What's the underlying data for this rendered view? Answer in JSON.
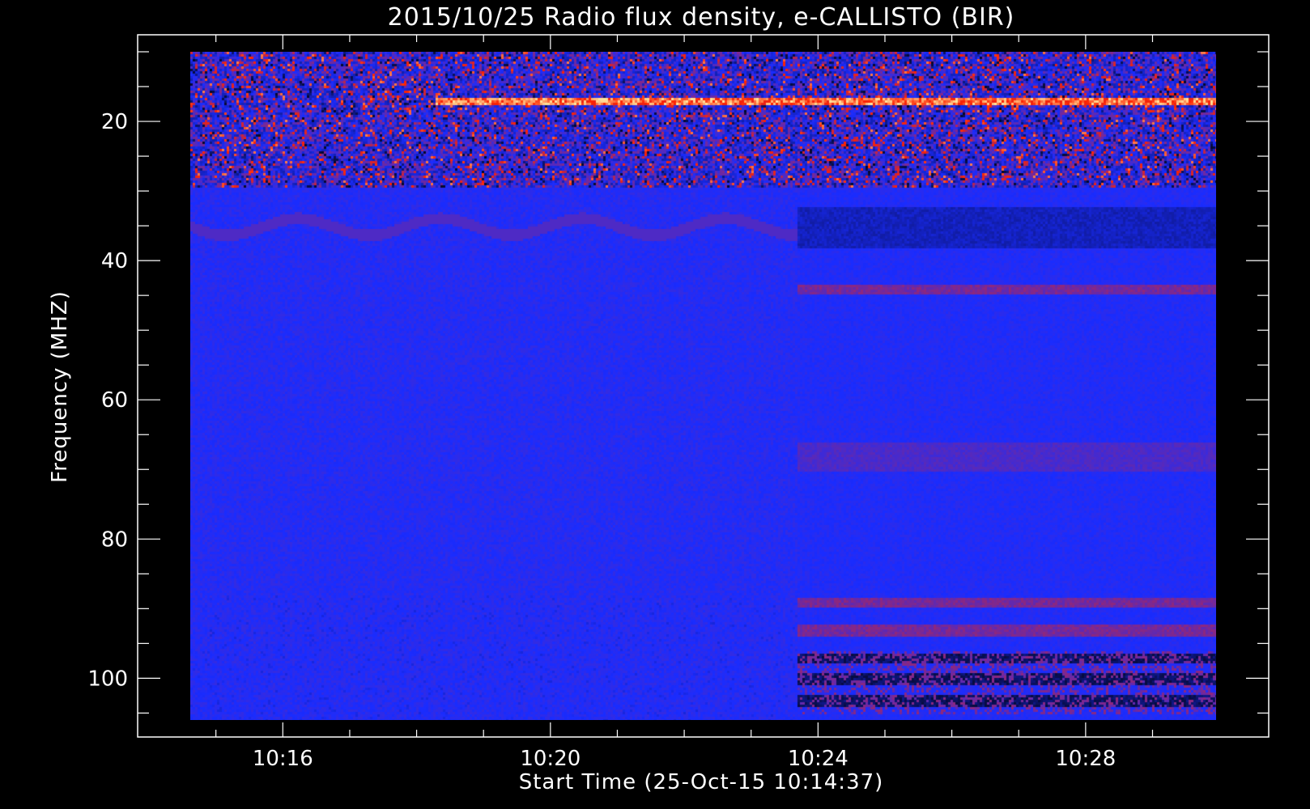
{
  "chart_data": {
    "type": "heatmap",
    "title": "2015/10/25  Radio flux density, e-CALLISTO (BIR)",
    "xlabel": "Start Time (25-Oct-15 10:14:37)",
    "ylabel": "Frequency (MHZ)",
    "x_axis": {
      "unit": "minutes",
      "start": "10:14:37",
      "range": [
        "10:14:37",
        "10:29:57"
      ],
      "ticks": [
        "10:16",
        "10:20",
        "10:24",
        "10:28"
      ],
      "tick_step_minutes": 4,
      "minor_tick_step_minutes": 1
    },
    "y_axis": {
      "unit": "MHz",
      "range": [
        10,
        106
      ],
      "inverted": true,
      "ticks": [
        20,
        40,
        60,
        80,
        100
      ],
      "minor_tick_step": 5
    },
    "colormap": {
      "low": "#000000",
      "mid": "#1a2cff",
      "high": "#ff2200",
      "max": "#ffe8a0"
    },
    "background_color": "#000000",
    "frame_color": "#ffffff",
    "regimes": [
      {
        "time_range": [
          "10:14:37",
          "10:23:40"
        ],
        "description": "uniform blue background, noisy red/black interference above 29 MHz"
      },
      {
        "time_range": [
          "10:23:40",
          "10:29:57"
        ],
        "description": "horizontal banding across frequencies, strong dark bands near 97-105 MHz"
      }
    ],
    "interference_bands_mhz": [
      17,
      21,
      28,
      29,
      44,
      89,
      93,
      97,
      100,
      103
    ],
    "grid": false,
    "legend": "none"
  }
}
